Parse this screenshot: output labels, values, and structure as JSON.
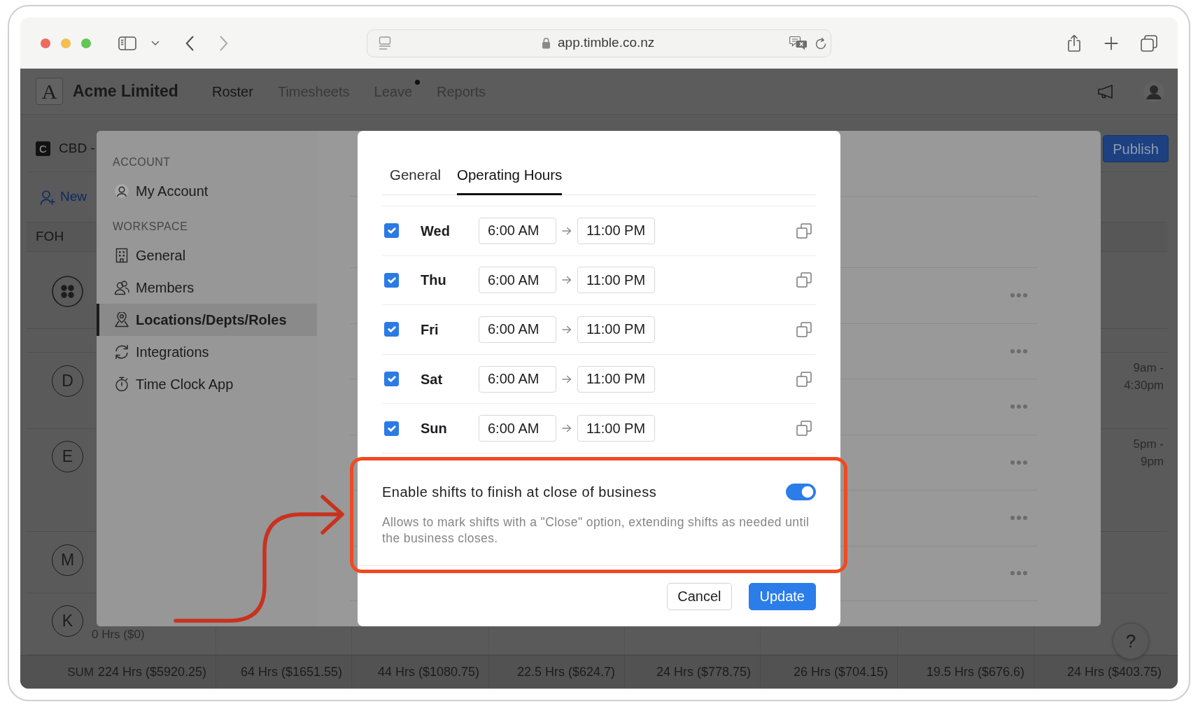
{
  "browser": {
    "url": "app.timble.co.nz"
  },
  "app_header": {
    "logo_letter": "A",
    "company": "Acme Limited",
    "nav": [
      {
        "label": "Roster",
        "selected": true,
        "dot": false
      },
      {
        "label": "Timesheets",
        "selected": false,
        "dot": false
      },
      {
        "label": "Leave",
        "selected": false,
        "dot": true
      },
      {
        "label": "Reports",
        "selected": false,
        "dot": false
      }
    ]
  },
  "roster": {
    "location_badge": "C",
    "location": "CBD -",
    "publish_button": "Publish",
    "new_member": "New",
    "group": "FOH",
    "staff": [
      {
        "kind": "group"
      },
      {
        "kind": "person",
        "initial": "D",
        "shift": "9am - 4:30pm"
      },
      {
        "kind": "person",
        "initial": "E",
        "shift": "5pm - 9pm"
      },
      {
        "kind": "person",
        "initial": "M"
      },
      {
        "kind": "person",
        "initial": "K",
        "hours": "0 Hrs ($0)"
      }
    ],
    "sum_row": {
      "label": "SUM",
      "totals": [
        "224 Hrs ($5920.25)",
        "64 Hrs ($1651.55)",
        "44 Hrs ($1080.75)",
        "22.5 Hrs ($624.7)",
        "24 Hrs ($778.75)",
        "26 Hrs ($704.15)",
        "19.5 Hrs ($676.6)",
        "24 Hrs ($403.75)"
      ]
    },
    "help_button": "?"
  },
  "settings": {
    "sections": [
      {
        "title": "ACCOUNT",
        "items": [
          {
            "label": "My Account",
            "selected": false
          }
        ]
      },
      {
        "title": "WORKSPACE",
        "items": [
          {
            "label": "General",
            "selected": false
          },
          {
            "label": "Members",
            "selected": false
          },
          {
            "label": "Locations/Depts/Roles",
            "selected": true
          },
          {
            "label": "Integrations",
            "selected": false
          },
          {
            "label": "Time Clock App",
            "selected": false
          }
        ]
      }
    ]
  },
  "modal": {
    "tabs": [
      {
        "label": "General",
        "selected": false
      },
      {
        "label": "Operating Hours",
        "selected": true
      }
    ],
    "days": [
      {
        "day": "Wed",
        "checked": true,
        "start": "6:00 AM",
        "end": "11:00 PM"
      },
      {
        "day": "Thu",
        "checked": true,
        "start": "6:00 AM",
        "end": "11:00 PM"
      },
      {
        "day": "Fri",
        "checked": true,
        "start": "6:00 AM",
        "end": "11:00 PM"
      },
      {
        "day": "Sat",
        "checked": true,
        "start": "6:00 AM",
        "end": "11:00 PM"
      },
      {
        "day": "Sun",
        "checked": true,
        "start": "6:00 AM",
        "end": "11:00 PM"
      }
    ],
    "close_of_business": {
      "label": "Enable shifts to finish at close of business",
      "on": true,
      "description": "Allows to mark shifts with a \"Close\" option, extending shifts as needed until the business closes."
    },
    "buttons": [
      {
        "label": "Cancel",
        "kind": "secondary"
      },
      {
        "label": "Update",
        "kind": "primary"
      }
    ]
  }
}
